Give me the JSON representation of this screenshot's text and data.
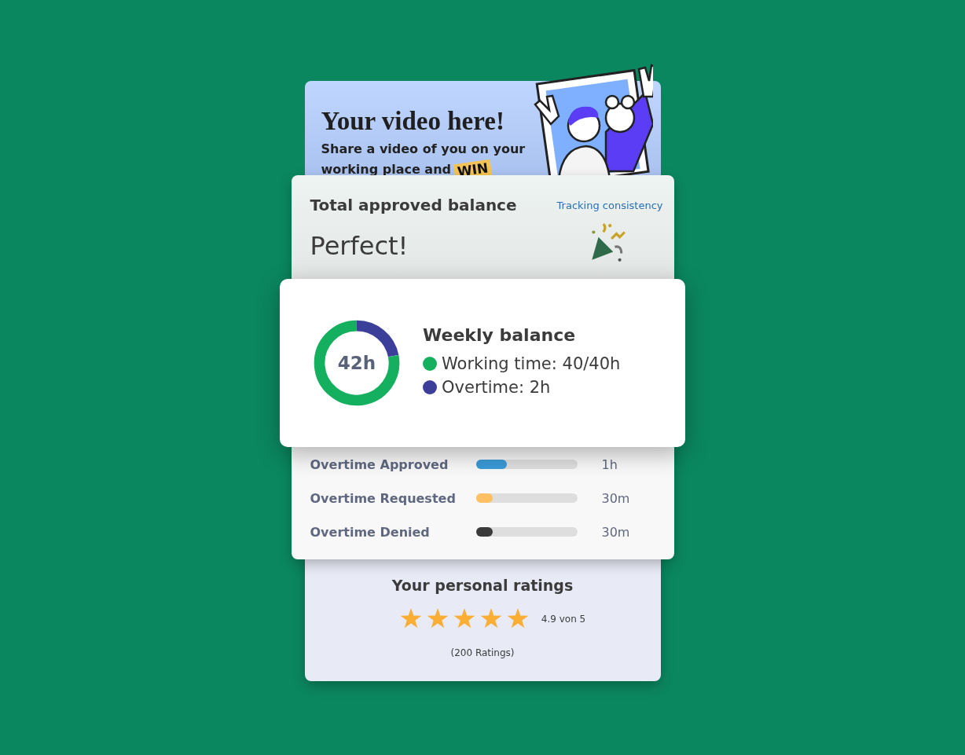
{
  "promo": {
    "title": "Your video here!",
    "lines": [
      "Share a video of you on your",
      "working place and"
    ],
    "badge": "WIN"
  },
  "balance": {
    "title": "Total approved balance",
    "link": "Tracking consistency",
    "status": "Perfect!"
  },
  "weekly": {
    "title": "Weekly balance",
    "center": "42h",
    "legend": [
      {
        "label": "Working time: 40/40h",
        "color": "#15b05f"
      },
      {
        "label": "Overtime: 2h",
        "color": "#3c3f9a"
      }
    ]
  },
  "overtime": [
    {
      "label": "Overtime Approved",
      "level": 0.31,
      "color": "#3a9ad6",
      "value": "1h"
    },
    {
      "label": "Overtime Requested",
      "level": 0.17,
      "color": "#fdc063",
      "value": "30m"
    },
    {
      "label": "Overtime Denied",
      "level": 0.17,
      "color": "#3b3b3b",
      "value": "30m"
    }
  ],
  "ratings": {
    "title": "Your personal ratings",
    "stars": 5,
    "score": "4.9 von 5",
    "count": "(200 Ratings)"
  }
}
